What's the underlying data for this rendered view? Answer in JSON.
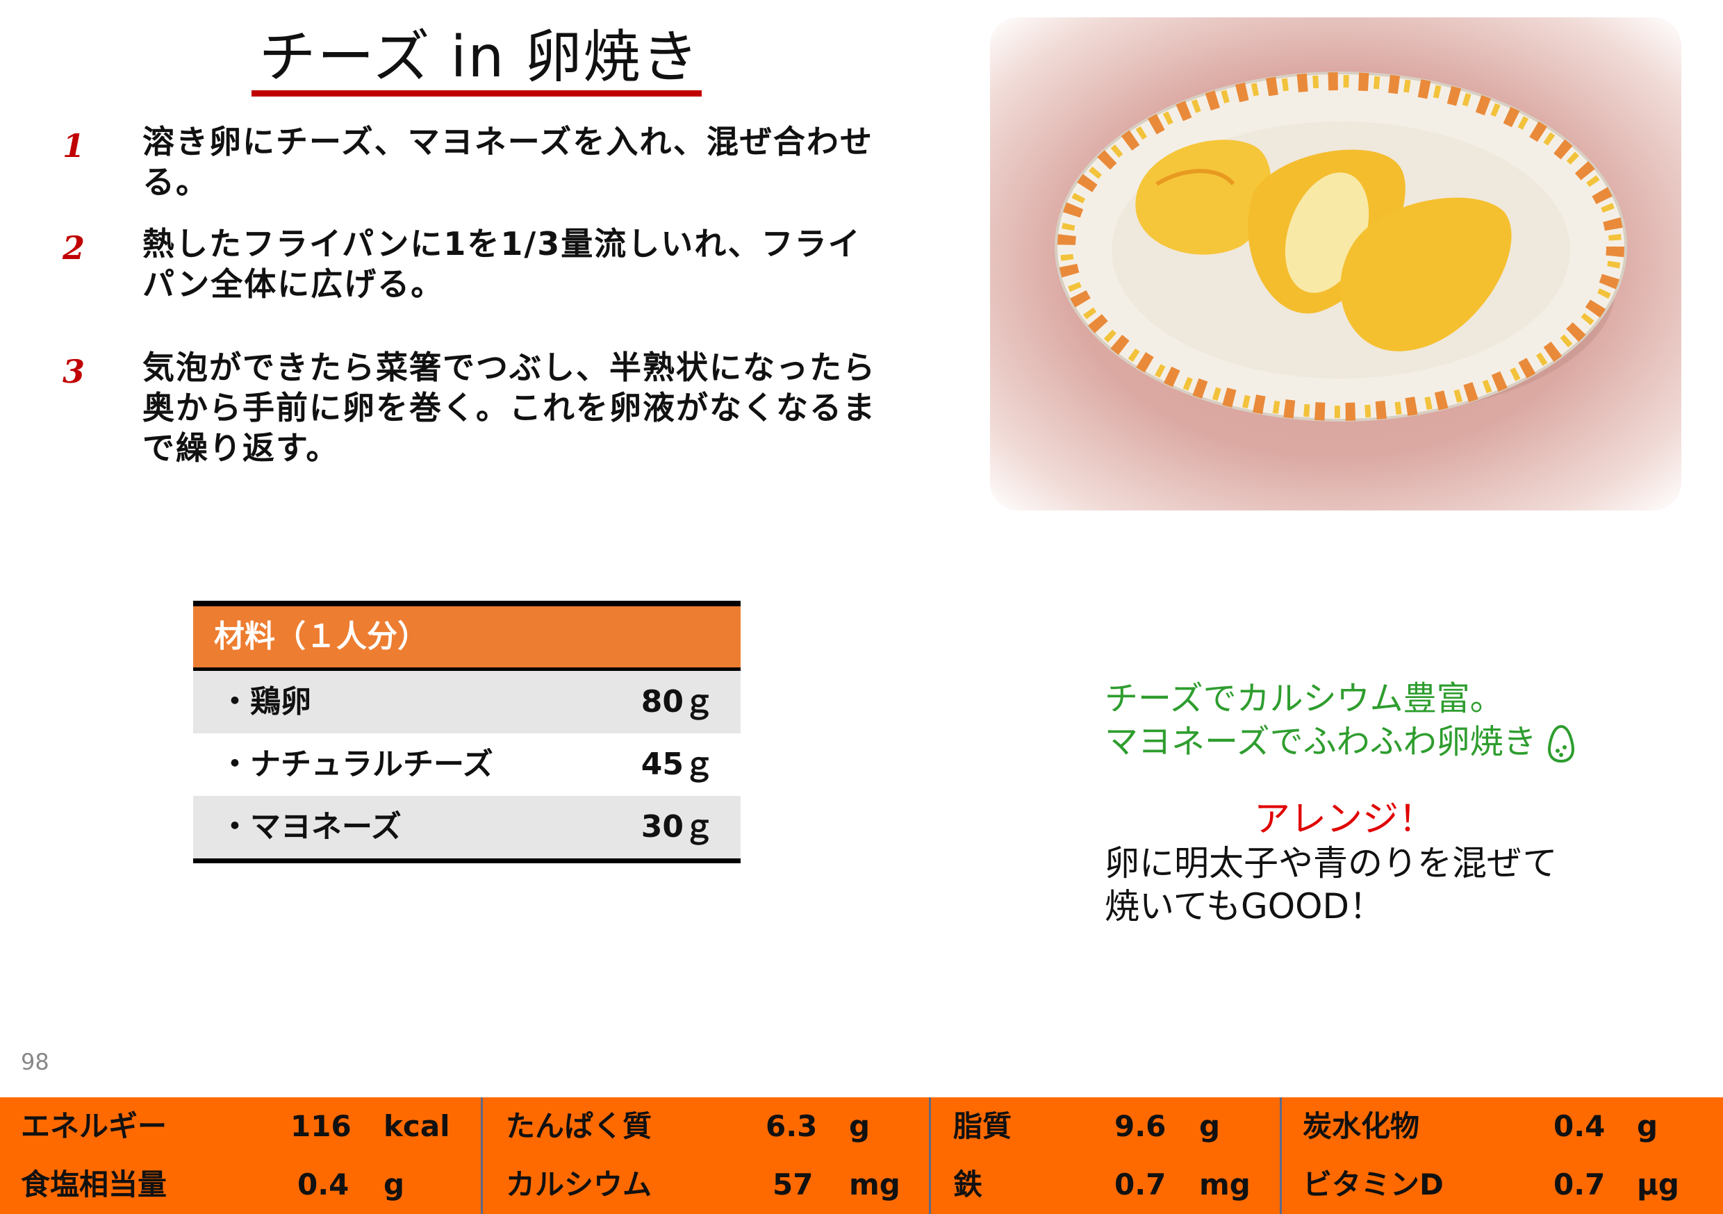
{
  "title": "チーズ in 卵焼き",
  "steps": [
    {
      "num": "1",
      "text": "溶き卵にチーズ、マヨネーズを入れ、混ぜ合わせる。"
    },
    {
      "num": "2",
      "text": "熱したフライパンに1を1/3量流しいれ、フライパン全体に広げる。"
    },
    {
      "num": "3",
      "text": "気泡ができたら菜箸でつぶし、半熟状になったら奥から手前に卵を巻く。これを卵液がなくなるまで繰り返す。"
    }
  ],
  "ingredients": {
    "header": "材料（１人分）",
    "items": [
      {
        "name": "・鶏卵",
        "amount": "80ｇ"
      },
      {
        "name": "・ナチュラルチーズ",
        "amount": "45ｇ"
      },
      {
        "name": "・マヨネーズ",
        "amount": "30ｇ"
      }
    ]
  },
  "notes": {
    "line1": "チーズでカルシウム豊富。",
    "line2": "マヨネーズでふわふわ卵焼き",
    "arrange_title": "アレンジ！",
    "arrange_line1": "卵に明太子や青のりを混ぜて",
    "arrange_line2": "焼いてもGOOD！"
  },
  "page_number": "98",
  "nutrition": [
    {
      "label": "エネルギー",
      "value": "116",
      "unit": "kcal"
    },
    {
      "label": "たんぱく質",
      "value": "6.3",
      "unit": "g"
    },
    {
      "label": "脂質",
      "value": "9.6",
      "unit": "g"
    },
    {
      "label": "炭水化物",
      "value": "0.4",
      "unit": "g"
    },
    {
      "label": "食塩相当量",
      "value": "0.4",
      "unit": "g"
    },
    {
      "label": "カルシウム",
      "value": "57",
      "unit": "mg"
    },
    {
      "label": "鉄",
      "value": "0.7",
      "unit": "mg"
    },
    {
      "label": "ビタミンD",
      "value": "0.7",
      "unit": "μg"
    }
  ],
  "colors": {
    "accent_red": "#c00000",
    "orange": "#ed7d31",
    "bar_orange": "#ff6a00",
    "green": "#2e9d2e"
  }
}
